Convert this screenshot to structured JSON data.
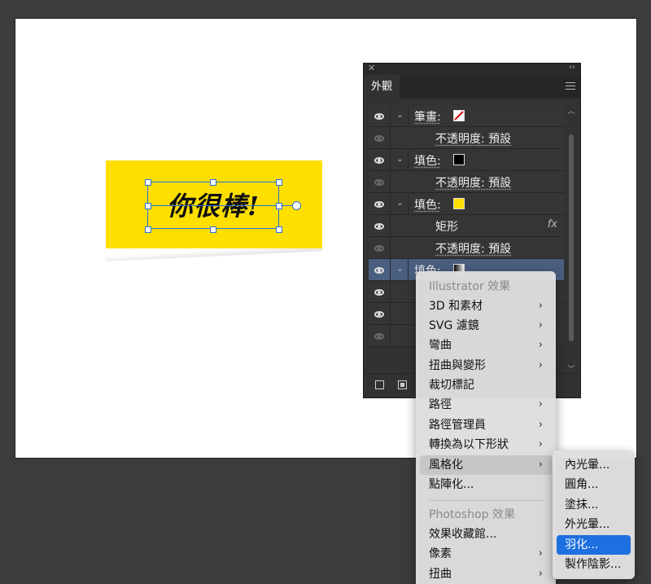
{
  "artwork": {
    "note_text": "你很棒!",
    "colors": {
      "note": "#ffdf00",
      "selection": "#2b6fd6",
      "highlight": "#1e6fe0"
    }
  },
  "appearance_panel": {
    "tab_label": "外觀",
    "rows": [
      {
        "label": "筆畫:",
        "swatch": "stroke-red-slash",
        "visible": true,
        "expand": true,
        "indent": false
      },
      {
        "label": "不透明度: 預設",
        "visible": false,
        "indent": true
      },
      {
        "label": "填色:",
        "swatch": "#000000",
        "visible": true,
        "expand": true,
        "indent": false
      },
      {
        "label": "不透明度: 預設",
        "visible": false,
        "indent": true
      },
      {
        "label": "填色:",
        "swatch": "#ffdf00",
        "visible": true,
        "expand": true,
        "indent": false
      },
      {
        "label": "矩形",
        "visible": true,
        "indent": true,
        "fx": "fx"
      },
      {
        "label": "不透明度: 預設",
        "visible": false,
        "indent": true
      },
      {
        "label": "填色:",
        "swatch": "gradient",
        "visible": true,
        "expand": true,
        "indent": false,
        "selected": true
      }
    ]
  },
  "effect_menu": {
    "illustrator_header": "Illustrator 效果",
    "illustrator_items": [
      {
        "label": "3D 和素材",
        "submenu": true
      },
      {
        "label": "SVG 濾鏡",
        "submenu": true
      },
      {
        "label": "彎曲",
        "submenu": true
      },
      {
        "label": "扭曲與變形",
        "submenu": true
      },
      {
        "label": "裁切標記",
        "submenu": false
      },
      {
        "label": "路徑",
        "submenu": true
      },
      {
        "label": "路徑管理員",
        "submenu": true
      },
      {
        "label": "轉換為以下形狀",
        "submenu": true
      },
      {
        "label": "風格化",
        "submenu": true,
        "hover": true
      },
      {
        "label": "點陣化...",
        "submenu": false
      }
    ],
    "photoshop_header": "Photoshop 效果",
    "photoshop_items": [
      {
        "label": "效果收藏館...",
        "submenu": false
      },
      {
        "label": "像素",
        "submenu": true
      },
      {
        "label": "扭曲",
        "submenu": true
      }
    ]
  },
  "stylize_submenu": {
    "items": [
      {
        "label": "內光暈..."
      },
      {
        "label": "圓角..."
      },
      {
        "label": "塗抹..."
      },
      {
        "label": "外光暈..."
      },
      {
        "label": "羽化...",
        "active": true
      },
      {
        "label": "製作陰影..."
      }
    ]
  }
}
